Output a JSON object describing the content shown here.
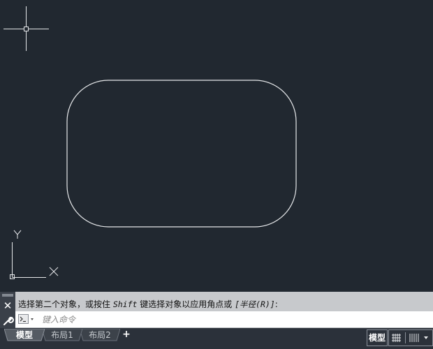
{
  "command_panel": {
    "history": {
      "part1": "选择第二个对象，或按住 ",
      "keyword": "Shift",
      "part2": " 键选择对象以应用角点或 ",
      "option": "[半径(R)]",
      "suffix": ":"
    },
    "input_placeholder": "键入命令",
    "close_icon": "close-icon",
    "customize_icon": "wrench-icon",
    "prompt_icon": "command-prompt-icon"
  },
  "layout_tabs": {
    "items": [
      {
        "label": "模型",
        "active": true
      },
      {
        "label": "布局1",
        "active": false
      },
      {
        "label": "布局2",
        "active": false
      }
    ],
    "add_label": "+"
  },
  "status": {
    "model_label": "模型"
  },
  "ucs": {
    "x_label": "X",
    "y_label": "Y"
  },
  "colors": {
    "canvas_background": "#212830",
    "geometry": "#e6e8ea",
    "command_bar": "#c7c9cc",
    "tab_active": "#555b63",
    "tab_inactive": "#3c424a"
  }
}
